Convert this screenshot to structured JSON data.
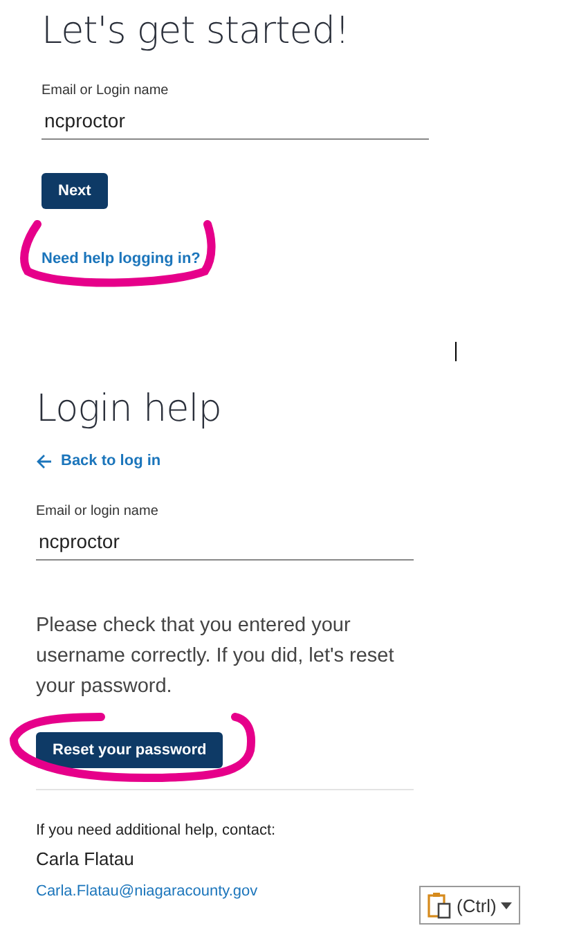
{
  "login": {
    "title": "Let's get started!",
    "field": {
      "label": "Email or Login name",
      "value": "ncproctor"
    },
    "next_button": "Next",
    "help_link": "Need help logging in?"
  },
  "login_help": {
    "title": "Login help",
    "back_link": "Back to log in",
    "field": {
      "label": "Email or login name",
      "value": "ncproctor"
    },
    "message": "Please check that you entered your username correctly. If you did, let's reset your password.",
    "reset_button": "Reset your password",
    "contact_intro": "If you need additional help, contact:",
    "contact_name": "Carla Flatau",
    "contact_email": "Carla.Flatau@niagaracounty.gov"
  },
  "paste_options": {
    "label": "(Ctrl)"
  }
}
